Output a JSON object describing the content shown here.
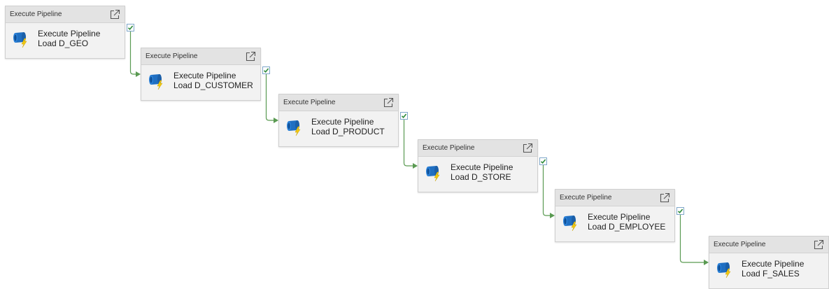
{
  "canvas": {
    "activities": [
      {
        "type_label": "Execute Pipeline",
        "line1": "Execute Pipeline",
        "line2": "Load D_GEO"
      },
      {
        "type_label": "Execute Pipeline",
        "line1": "Execute Pipeline",
        "line2": "Load D_CUSTOMER"
      },
      {
        "type_label": "Execute Pipeline",
        "line1": "Execute Pipeline",
        "line2": "Load D_PRODUCT"
      },
      {
        "type_label": "Execute Pipeline",
        "line1": "Execute Pipeline",
        "line2": "Load D_STORE"
      },
      {
        "type_label": "Execute Pipeline",
        "line1": "Execute Pipeline",
        "line2": "Load D_EMPLOYEE"
      },
      {
        "type_label": "Execute Pipeline",
        "line1": "Execute Pipeline",
        "line2": "Load F_SALES"
      }
    ],
    "icons": {
      "activity": "execute-pipeline-icon",
      "open": "open-external-icon",
      "handle": "success-check-icon"
    },
    "colors": {
      "connector": "#5a9a52",
      "check": "#2e8b3a",
      "pipe_blue": "#1f6fc2",
      "bolt_yellow": "#f2c811"
    }
  }
}
